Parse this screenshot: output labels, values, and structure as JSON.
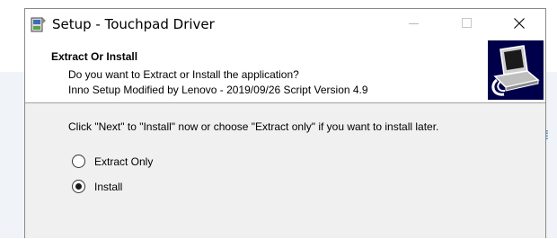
{
  "window": {
    "title": "Setup - Touchpad Driver",
    "controls": {
      "minimize": "minimize-icon",
      "maximize": "maximize-icon",
      "close": "close-icon"
    }
  },
  "header": {
    "title": "Extract Or Install",
    "subtitle_line1": "Do you want to Extract or Install the application?",
    "subtitle_line2": "Inno Setup Modified by Lenovo - 2019/09/26 Script Version 4.9"
  },
  "main": {
    "instruction": "Click \"Next\" to \"Install\" now or choose \"Extract only\" if you want to install later.",
    "options": [
      {
        "label": "Extract Only",
        "selected": false
      },
      {
        "label": "Install",
        "selected": true
      }
    ]
  },
  "colors": {
    "wizard_image_bg": "#00004a",
    "dialog_bg": "#f0f0f0",
    "link_accent": "#2a6fb0"
  }
}
